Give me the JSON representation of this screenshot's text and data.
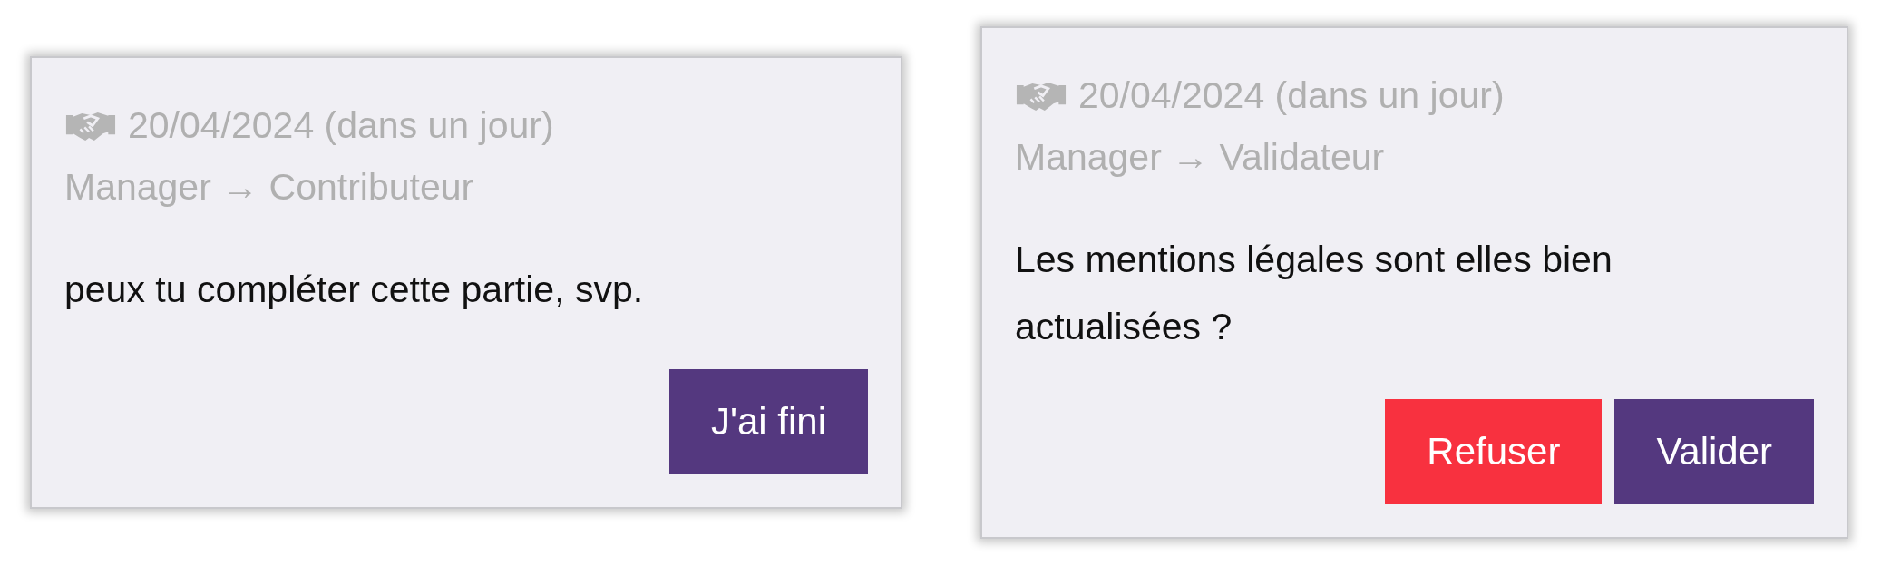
{
  "cards": [
    {
      "date": "20/04/2024 (dans un jour)",
      "roles": "Manager → Contributeur",
      "message": "peux tu compléter cette partie, svp.",
      "buttons": [
        {
          "label": "J'ai fini",
          "kind": "primary"
        }
      ]
    },
    {
      "date": "20/04/2024 (dans un jour)",
      "roles": "Manager → Validateur",
      "message": "Les mentions légales sont elles bien actualisées ?",
      "buttons": [
        {
          "label": "Refuser",
          "kind": "danger"
        },
        {
          "label": "Valider",
          "kind": "primary"
        }
      ]
    }
  ]
}
